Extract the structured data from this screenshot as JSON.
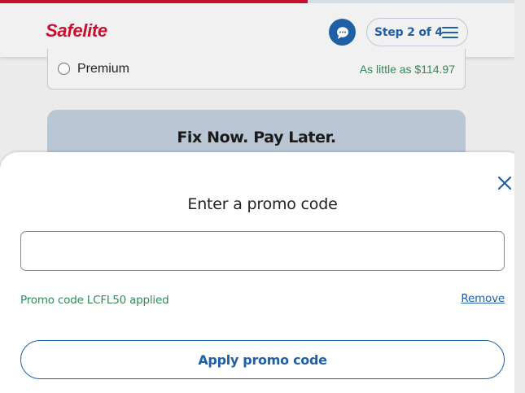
{
  "colors": {
    "brand_red": "#c8102e",
    "brand_blue": "#1f5fa6",
    "success_green": "#2e8b57"
  },
  "progress": {
    "fraction": 0.586
  },
  "header": {
    "logo": "Safelite",
    "chat_icon": "chat-bubble-icon",
    "step_label": "Step 2 of 4",
    "menu_icon": "hamburger-menu-icon"
  },
  "background": {
    "option_label": "Premium",
    "option_price": "As little as $114.97",
    "banner_title": "Fix Now. Pay Later."
  },
  "modal": {
    "close_icon": "close-icon",
    "title": "Enter a promo code",
    "input_value": "",
    "input_placeholder": "",
    "applied_message": "Promo code LCFL50 applied",
    "remove_label": "Remove",
    "apply_label": "Apply promo code"
  }
}
